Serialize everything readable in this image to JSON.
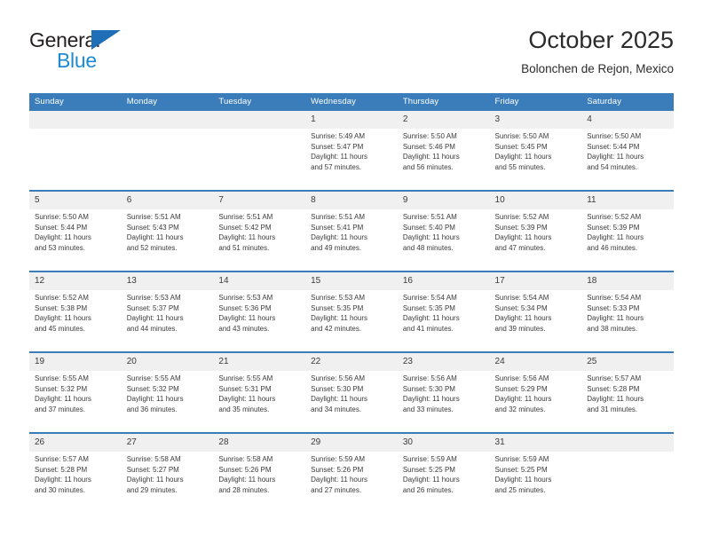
{
  "brand": {
    "name_part1": "General",
    "name_part2": "Blue",
    "accent_color": "#1e8ad6",
    "triangle_color": "#1e6eb8"
  },
  "header": {
    "title": "October 2025",
    "subtitle": "Bolonchen de Rejon, Mexico"
  },
  "theme": {
    "header_band": "#3b7dba",
    "daynum_band": "#f0f0f0",
    "text": "#3a3a3a"
  },
  "weekdays": [
    "Sunday",
    "Monday",
    "Tuesday",
    "Wednesday",
    "Thursday",
    "Friday",
    "Saturday"
  ],
  "labels": {
    "sunrise_prefix": "Sunrise:",
    "sunset_prefix": "Sunset:",
    "daylight_prefix": "Daylight:"
  },
  "weeks": [
    [
      {
        "day": "",
        "blank": true,
        "line1": "",
        "line2": "",
        "line3": "",
        "line4": ""
      },
      {
        "day": "",
        "blank": true,
        "line1": "",
        "line2": "",
        "line3": "",
        "line4": ""
      },
      {
        "day": "",
        "blank": true,
        "line1": "",
        "line2": "",
        "line3": "",
        "line4": ""
      },
      {
        "day": "1",
        "blank": false,
        "line1": "Sunrise: 5:49 AM",
        "line2": "Sunset: 5:47 PM",
        "line3": "Daylight: 11 hours",
        "line4": "and 57 minutes."
      },
      {
        "day": "2",
        "blank": false,
        "line1": "Sunrise: 5:50 AM",
        "line2": "Sunset: 5:46 PM",
        "line3": "Daylight: 11 hours",
        "line4": "and 56 minutes."
      },
      {
        "day": "3",
        "blank": false,
        "line1": "Sunrise: 5:50 AM",
        "line2": "Sunset: 5:45 PM",
        "line3": "Daylight: 11 hours",
        "line4": "and 55 minutes."
      },
      {
        "day": "4",
        "blank": false,
        "line1": "Sunrise: 5:50 AM",
        "line2": "Sunset: 5:44 PM",
        "line3": "Daylight: 11 hours",
        "line4": "and 54 minutes."
      }
    ],
    [
      {
        "day": "5",
        "blank": false,
        "line1": "Sunrise: 5:50 AM",
        "line2": "Sunset: 5:44 PM",
        "line3": "Daylight: 11 hours",
        "line4": "and 53 minutes."
      },
      {
        "day": "6",
        "blank": false,
        "line1": "Sunrise: 5:51 AM",
        "line2": "Sunset: 5:43 PM",
        "line3": "Daylight: 11 hours",
        "line4": "and 52 minutes."
      },
      {
        "day": "7",
        "blank": false,
        "line1": "Sunrise: 5:51 AM",
        "line2": "Sunset: 5:42 PM",
        "line3": "Daylight: 11 hours",
        "line4": "and 51 minutes."
      },
      {
        "day": "8",
        "blank": false,
        "line1": "Sunrise: 5:51 AM",
        "line2": "Sunset: 5:41 PM",
        "line3": "Daylight: 11 hours",
        "line4": "and 49 minutes."
      },
      {
        "day": "9",
        "blank": false,
        "line1": "Sunrise: 5:51 AM",
        "line2": "Sunset: 5:40 PM",
        "line3": "Daylight: 11 hours",
        "line4": "and 48 minutes."
      },
      {
        "day": "10",
        "blank": false,
        "line1": "Sunrise: 5:52 AM",
        "line2": "Sunset: 5:39 PM",
        "line3": "Daylight: 11 hours",
        "line4": "and 47 minutes."
      },
      {
        "day": "11",
        "blank": false,
        "line1": "Sunrise: 5:52 AM",
        "line2": "Sunset: 5:39 PM",
        "line3": "Daylight: 11 hours",
        "line4": "and 46 minutes."
      }
    ],
    [
      {
        "day": "12",
        "blank": false,
        "line1": "Sunrise: 5:52 AM",
        "line2": "Sunset: 5:38 PM",
        "line3": "Daylight: 11 hours",
        "line4": "and 45 minutes."
      },
      {
        "day": "13",
        "blank": false,
        "line1": "Sunrise: 5:53 AM",
        "line2": "Sunset: 5:37 PM",
        "line3": "Daylight: 11 hours",
        "line4": "and 44 minutes."
      },
      {
        "day": "14",
        "blank": false,
        "line1": "Sunrise: 5:53 AM",
        "line2": "Sunset: 5:36 PM",
        "line3": "Daylight: 11 hours",
        "line4": "and 43 minutes."
      },
      {
        "day": "15",
        "blank": false,
        "line1": "Sunrise: 5:53 AM",
        "line2": "Sunset: 5:35 PM",
        "line3": "Daylight: 11 hours",
        "line4": "and 42 minutes."
      },
      {
        "day": "16",
        "blank": false,
        "line1": "Sunrise: 5:54 AM",
        "line2": "Sunset: 5:35 PM",
        "line3": "Daylight: 11 hours",
        "line4": "and 41 minutes."
      },
      {
        "day": "17",
        "blank": false,
        "line1": "Sunrise: 5:54 AM",
        "line2": "Sunset: 5:34 PM",
        "line3": "Daylight: 11 hours",
        "line4": "and 39 minutes."
      },
      {
        "day": "18",
        "blank": false,
        "line1": "Sunrise: 5:54 AM",
        "line2": "Sunset: 5:33 PM",
        "line3": "Daylight: 11 hours",
        "line4": "and 38 minutes."
      }
    ],
    [
      {
        "day": "19",
        "blank": false,
        "line1": "Sunrise: 5:55 AM",
        "line2": "Sunset: 5:32 PM",
        "line3": "Daylight: 11 hours",
        "line4": "and 37 minutes."
      },
      {
        "day": "20",
        "blank": false,
        "line1": "Sunrise: 5:55 AM",
        "line2": "Sunset: 5:32 PM",
        "line3": "Daylight: 11 hours",
        "line4": "and 36 minutes."
      },
      {
        "day": "21",
        "blank": false,
        "line1": "Sunrise: 5:55 AM",
        "line2": "Sunset: 5:31 PM",
        "line3": "Daylight: 11 hours",
        "line4": "and 35 minutes."
      },
      {
        "day": "22",
        "blank": false,
        "line1": "Sunrise: 5:56 AM",
        "line2": "Sunset: 5:30 PM",
        "line3": "Daylight: 11 hours",
        "line4": "and 34 minutes."
      },
      {
        "day": "23",
        "blank": false,
        "line1": "Sunrise: 5:56 AM",
        "line2": "Sunset: 5:30 PM",
        "line3": "Daylight: 11 hours",
        "line4": "and 33 minutes."
      },
      {
        "day": "24",
        "blank": false,
        "line1": "Sunrise: 5:56 AM",
        "line2": "Sunset: 5:29 PM",
        "line3": "Daylight: 11 hours",
        "line4": "and 32 minutes."
      },
      {
        "day": "25",
        "blank": false,
        "line1": "Sunrise: 5:57 AM",
        "line2": "Sunset: 5:28 PM",
        "line3": "Daylight: 11 hours",
        "line4": "and 31 minutes."
      }
    ],
    [
      {
        "day": "26",
        "blank": false,
        "line1": "Sunrise: 5:57 AM",
        "line2": "Sunset: 5:28 PM",
        "line3": "Daylight: 11 hours",
        "line4": "and 30 minutes."
      },
      {
        "day": "27",
        "blank": false,
        "line1": "Sunrise: 5:58 AM",
        "line2": "Sunset: 5:27 PM",
        "line3": "Daylight: 11 hours",
        "line4": "and 29 minutes."
      },
      {
        "day": "28",
        "blank": false,
        "line1": "Sunrise: 5:58 AM",
        "line2": "Sunset: 5:26 PM",
        "line3": "Daylight: 11 hours",
        "line4": "and 28 minutes."
      },
      {
        "day": "29",
        "blank": false,
        "line1": "Sunrise: 5:59 AM",
        "line2": "Sunset: 5:26 PM",
        "line3": "Daylight: 11 hours",
        "line4": "and 27 minutes."
      },
      {
        "day": "30",
        "blank": false,
        "line1": "Sunrise: 5:59 AM",
        "line2": "Sunset: 5:25 PM",
        "line3": "Daylight: 11 hours",
        "line4": "and 26 minutes."
      },
      {
        "day": "31",
        "blank": false,
        "line1": "Sunrise: 5:59 AM",
        "line2": "Sunset: 5:25 PM",
        "line3": "Daylight: 11 hours",
        "line4": "and 25 minutes."
      },
      {
        "day": "",
        "blank": true,
        "line1": "",
        "line2": "",
        "line3": "",
        "line4": ""
      }
    ]
  ]
}
